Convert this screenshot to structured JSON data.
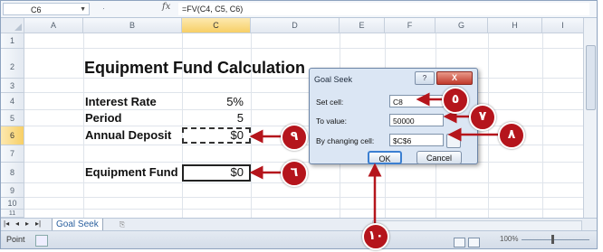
{
  "formula_bar": {
    "name_box": "C6",
    "fx": "fx",
    "formula": "=FV(C4, C5, C6)"
  },
  "columns": [
    "A",
    "B",
    "C",
    "D",
    "E",
    "F",
    "G",
    "H",
    "I"
  ],
  "rows": [
    "1",
    "2",
    "3",
    "4",
    "5",
    "6",
    "7",
    "8",
    "9",
    "10",
    "11"
  ],
  "sheet": {
    "title": "Equipment Fund Calculation",
    "interest_rate_label": "Interest Rate",
    "interest_rate_value": "5%",
    "period_label": "Period",
    "period_value": "5",
    "annual_deposit_label": "Annual Deposit",
    "annual_deposit_value": "$0",
    "equipment_fund_label": "Equipment Fund",
    "equipment_fund_value": "$0"
  },
  "dialog": {
    "title": "Goal Seek",
    "help": "?",
    "close": "X",
    "set_cell_label": "Set cell:",
    "set_cell_value": "C8",
    "to_value_label": "To value:",
    "to_value_value": "50000",
    "by_changing_label": "By changing cell:",
    "by_changing_value": "$C$6",
    "ok": "OK",
    "cancel": "Cancel"
  },
  "tabs": {
    "nav": [
      "|◂",
      "◂",
      "▸",
      "▸|"
    ],
    "sheet_name": "Goal Seek",
    "new_sheet": "⎘"
  },
  "status": {
    "mode": "Point",
    "zoom": "100%"
  },
  "callouts": {
    "c5": "٥",
    "c6": "٦",
    "c7": "٧",
    "c8": "٨",
    "c9": "٩",
    "c10": "١٠"
  },
  "colors": {
    "callout": "#b5151c",
    "selected_header": "#f7cf66"
  }
}
